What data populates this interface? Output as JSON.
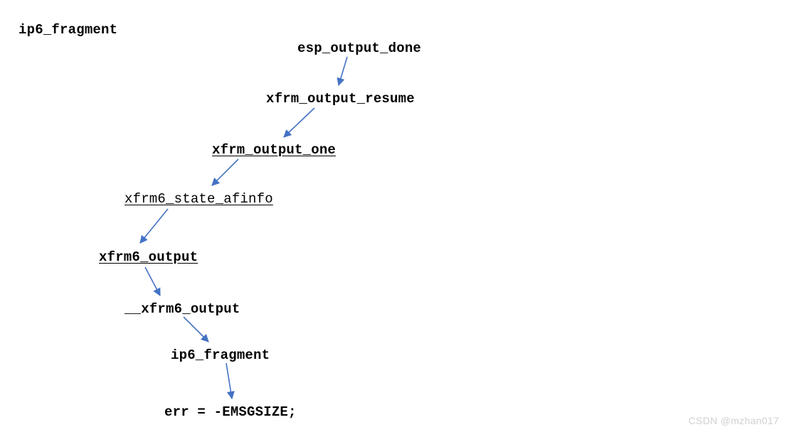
{
  "title": "ip6_fragment",
  "nodes": {
    "esp_output_done": {
      "label": "esp_output_done"
    },
    "xfrm_output_resume": {
      "label": "xfrm_output_resume"
    },
    "xfrm_output_one": {
      "label": "xfrm_output_one"
    },
    "xfrm6_state_afinfo": {
      "label": "xfrm6_state_afinfo"
    },
    "xfrm6_output": {
      "label": "xfrm6_output"
    },
    "xfrm6_output_inner": {
      "label": "__xfrm6_output"
    },
    "ip6_fragment": {
      "label": "ip6_fragment"
    },
    "err_line": {
      "label": "err = -EMSGSIZE;"
    }
  },
  "arrow_color": "#4472C4",
  "watermark": "CSDN @mzhan017"
}
